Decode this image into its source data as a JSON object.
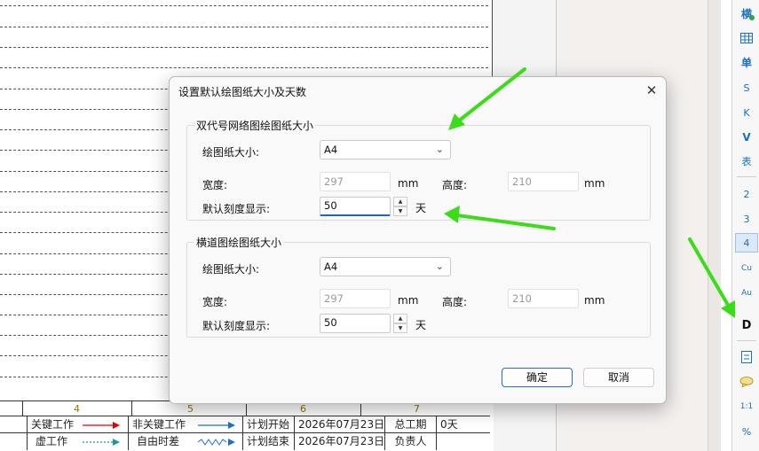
{
  "dialog": {
    "title": "设置默认绘图纸大小及天数",
    "close_glyph": "✕",
    "double_code": {
      "title": "双代号网络图绘图纸大小",
      "paper_label": "绘图纸大小:",
      "paper_value": "A4",
      "width_label": "宽度:",
      "width_value": "297",
      "height_label": "高度:",
      "height_value": "210",
      "unit_mm": "mm",
      "scale_label": "默认刻度显示:",
      "scale_value": "50",
      "unit_day": "天"
    },
    "gantt": {
      "title": "横道图绘图纸大小",
      "paper_label": "绘图纸大小:",
      "paper_value": "A4",
      "width_label": "宽度:",
      "width_value": "297",
      "height_label": "高度:",
      "height_value": "210",
      "unit_mm": "mm",
      "scale_label": "默认刻度显示:",
      "scale_value": "50",
      "unit_day": "天"
    },
    "ok_label": "确定",
    "cancel_label": "取消"
  },
  "legend": {
    "scale_numbers": [
      "4",
      "5",
      "6",
      "7"
    ],
    "row1": {
      "critical": "关键工作",
      "noncritical": "非关键工作",
      "plan_start_label": "计划开始",
      "plan_start_value": "2026年07月23日",
      "duration_label": "总工期",
      "duration_value": "0天"
    },
    "row2": {
      "dummy": "虚工作",
      "free_float": "自由时差",
      "plan_end_label": "计划结束",
      "plan_end_value": "2026年07月23日",
      "owner_label": "负责人"
    },
    "colors": {
      "critical_arrow": "#e00000",
      "noncritical_arrow": "#1f6fd0",
      "dummy_arrow": "#1a9a9a",
      "free_float_arrow": "#1f6fd0"
    }
  },
  "toolbar": {
    "items": [
      "横",
      "单",
      "S",
      "K",
      "V",
      "表",
      "2",
      "3",
      "4",
      "Cu",
      "Au",
      "D",
      "1:1",
      "%"
    ],
    "active": "4",
    "icons": [
      "gantt-icon",
      "grid-icon",
      "note-icon",
      "comment-icon"
    ]
  },
  "annotation_color": "#3ddc1a"
}
